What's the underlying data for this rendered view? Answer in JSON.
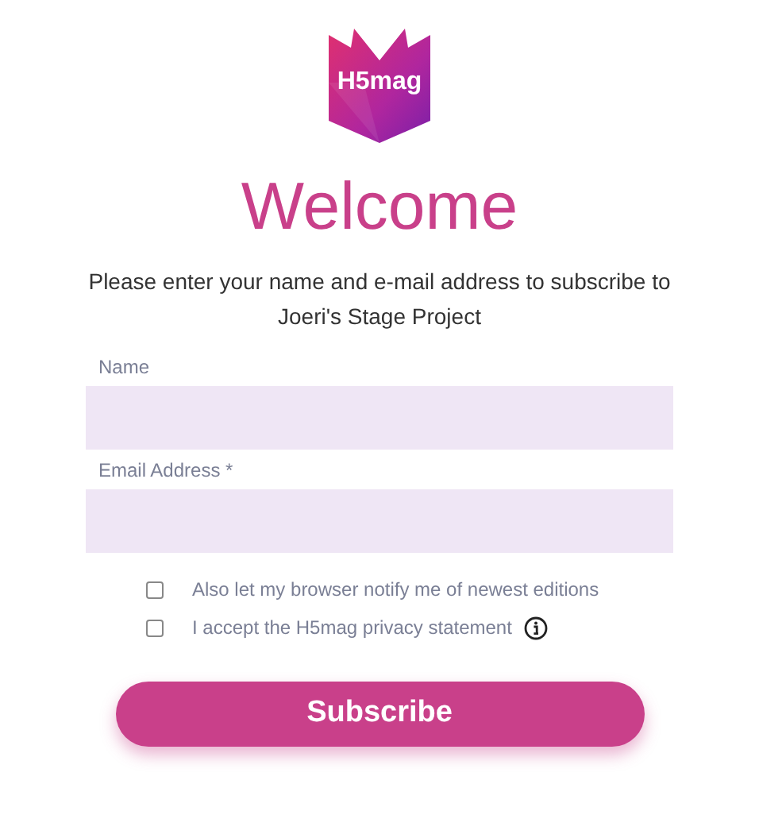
{
  "logo": {
    "text": "H5mag"
  },
  "title": "Welcome",
  "intro": "Please enter your name and e-mail address to subscribe to Joeri's Stage Project",
  "fields": [
    {
      "label": "Name"
    },
    {
      "label": "Email Address *"
    }
  ],
  "checkboxes": [
    {
      "label": "Also let my browser notify me of newest editions",
      "checked": false,
      "info": false
    },
    {
      "label": "I accept the H5mag privacy statement",
      "checked": false,
      "info": true
    }
  ],
  "button": "Subscribe"
}
